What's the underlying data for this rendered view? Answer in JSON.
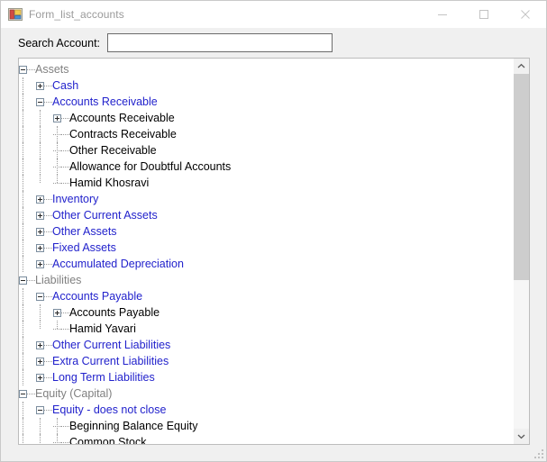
{
  "window": {
    "title": "Form_list_accounts",
    "icon": "form-window-icon",
    "title_color": "#9a9a9a",
    "minimize_label": "Minimize",
    "maximize_label": "Maximize",
    "close_label": "Close"
  },
  "search": {
    "label": "Search Account:",
    "value": "",
    "placeholder": ""
  },
  "colors": {
    "group_header": "#808080",
    "category": "#2222cc",
    "account": "#000000",
    "tree_border": "#bcbcbc",
    "scroll_thumb": "#cdcdcd"
  },
  "scrollbar": {
    "up_arrow": "chevron-up-icon",
    "down_arrow": "chevron-down-icon",
    "thumb_percent": 58
  },
  "tree": {
    "nodes": [
      {
        "label": "Assets",
        "level": 0,
        "state": "expanded",
        "style": "gray"
      },
      {
        "label": "Cash",
        "level": 1,
        "state": "collapsed",
        "style": "blue"
      },
      {
        "label": "Accounts Receivable",
        "level": 1,
        "state": "expanded",
        "style": "blue"
      },
      {
        "label": "Accounts Receivable",
        "level": 2,
        "state": "collapsed",
        "style": "black"
      },
      {
        "label": "Contracts Receivable",
        "level": 2,
        "state": "leaf",
        "style": "black"
      },
      {
        "label": "Other Receivable",
        "level": 2,
        "state": "leaf",
        "style": "black"
      },
      {
        "label": "Allowance for Doubtful Accounts",
        "level": 2,
        "state": "leaf",
        "style": "black"
      },
      {
        "label": "Hamid Khosravi",
        "level": 2,
        "state": "leaf-last",
        "style": "black"
      },
      {
        "label": "Inventory",
        "level": 1,
        "state": "collapsed",
        "style": "blue"
      },
      {
        "label": "Other Current Assets",
        "level": 1,
        "state": "collapsed",
        "style": "blue"
      },
      {
        "label": "Other Assets",
        "level": 1,
        "state": "collapsed",
        "style": "blue"
      },
      {
        "label": "Fixed Assets",
        "level": 1,
        "state": "collapsed",
        "style": "blue"
      },
      {
        "label": "Accumulated Depreciation",
        "level": 1,
        "state": "collapsed",
        "style": "blue"
      },
      {
        "label": "Liabilities",
        "level": 0,
        "state": "expanded",
        "style": "gray"
      },
      {
        "label": "Accounts Payable",
        "level": 1,
        "state": "expanded",
        "style": "blue"
      },
      {
        "label": "Accounts Payable",
        "level": 2,
        "state": "collapsed",
        "style": "black"
      },
      {
        "label": "Hamid Yavari",
        "level": 2,
        "state": "leaf-last",
        "style": "black"
      },
      {
        "label": "Other Current Liabilities",
        "level": 1,
        "state": "collapsed",
        "style": "blue"
      },
      {
        "label": "Extra Current Liabilities",
        "level": 1,
        "state": "collapsed",
        "style": "blue"
      },
      {
        "label": "Long Term Liabilities",
        "level": 1,
        "state": "collapsed",
        "style": "blue"
      },
      {
        "label": "Equity (Capital)",
        "level": 0,
        "state": "expanded",
        "style": "gray"
      },
      {
        "label": "Equity - does not close",
        "level": 1,
        "state": "expanded",
        "style": "blue"
      },
      {
        "label": "Beginning Balance Equity",
        "level": 2,
        "state": "leaf",
        "style": "black"
      },
      {
        "label": "Common Stock",
        "level": 2,
        "state": "leaf",
        "style": "black"
      }
    ]
  }
}
